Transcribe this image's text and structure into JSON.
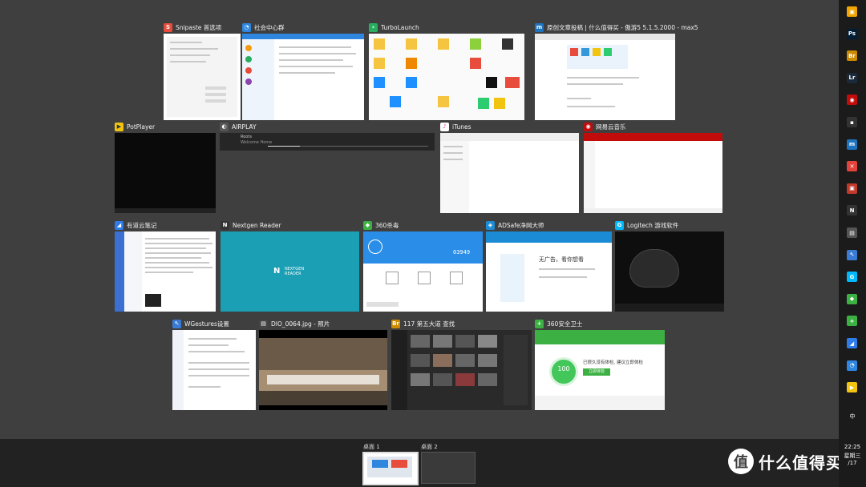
{
  "windows": {
    "snipaste": {
      "title": "Snipaste 首选项",
      "icon": "snipaste-icon",
      "color": "#e74c3c"
    },
    "social": {
      "title": "社会中心群",
      "icon": "tim-icon",
      "color": "#2e86de"
    },
    "turbolaunch": {
      "title": "TurboLaunch",
      "icon": "turbolaunch-icon",
      "color": "#27ae60"
    },
    "maxthon": {
      "title": "原创文章投稿 | 什么值得买 - 傲游5 5.1.5.2000 - max5",
      "icon": "maxthon-icon",
      "color": "#1e73be"
    },
    "potplayer": {
      "title": "PotPlayer",
      "icon": "potplayer-icon",
      "color": "#f1c40f"
    },
    "airplay": {
      "title": "AIRPLAY",
      "icon": "airplay-icon",
      "color": "#555555",
      "track": "Roots",
      "artist": "Welcome Home"
    },
    "itunes": {
      "title": "iTunes",
      "icon": "itunes-icon",
      "color": "#ffffff"
    },
    "netease_music": {
      "title": "网易云音乐",
      "icon": "netease-music-icon",
      "color": "#c20c0c"
    },
    "youdao": {
      "title": "有道云笔记",
      "icon": "youdao-note-icon",
      "color": "#2f7ce8"
    },
    "nextgen": {
      "title": "Nextgen Reader",
      "icon": "nextgen-icon",
      "color": "#1a9fb5",
      "logo_line1": "NEXTGEN",
      "logo_line2": "READER"
    },
    "antivirus360": {
      "title": "360杀毒",
      "icon": "360-antivirus-icon",
      "color": "#3cb043",
      "count": "03949"
    },
    "adsafe": {
      "title": "ADSafe净网大师",
      "icon": "adsafe-icon",
      "color": "#1c8bd6",
      "headline": "无广告，看你想看"
    },
    "logitech": {
      "title": "Logitech 游戏软件",
      "icon": "logitech-icon",
      "color": "#00b8fc"
    },
    "wgestures": {
      "title": "WGestures设置",
      "icon": "wgestures-icon",
      "color": "#3a7bd5"
    },
    "photo": {
      "title": "DIO_0064.jpg - 照片",
      "icon": "photos-icon",
      "color": "#444444"
    },
    "bridge": {
      "title": "117 第五大道 查找",
      "icon": "bridge-icon",
      "color": "#cc8a00",
      "icon_text": "Br"
    },
    "safeguard360": {
      "title": "360安全卫士",
      "icon": "360-safe-icon",
      "color": "#3cb043",
      "score": "100",
      "message": "已很久没有体检, 建议立即体检",
      "button": "立即体检"
    }
  },
  "desktops": [
    {
      "label": "桌面 1",
      "active": true
    },
    {
      "label": "桌面 2",
      "active": false
    }
  ],
  "clock": {
    "time": "22:25",
    "weekday": "星期三",
    "date": "/17"
  },
  "ime": "中",
  "watermark": {
    "symbol": "值",
    "text": "什么值得买"
  },
  "taskbar_icons": [
    {
      "name": "store-icon",
      "color": "#f0a500",
      "text": "▣"
    },
    {
      "name": "photoshop-icon",
      "color": "#001e36",
      "text": "Ps"
    },
    {
      "name": "bridge-icon",
      "color": "#cc8a00",
      "text": "Br"
    },
    {
      "name": "lightroom-icon",
      "color": "#1b2a3a",
      "text": "Lr"
    },
    {
      "name": "netease-music-icon",
      "color": "#c20c0c",
      "text": "◉"
    },
    {
      "name": "unknown-app-icon",
      "color": "#333333",
      "text": "▪"
    },
    {
      "name": "maxthon-icon",
      "color": "#1e73be",
      "text": "m"
    },
    {
      "name": "xmind-icon",
      "color": "#e2433a",
      "text": "✕"
    },
    {
      "name": "present-icon",
      "color": "#c0392b",
      "text": "▣"
    },
    {
      "name": "nextgen-icon",
      "color": "#333333",
      "text": "N"
    },
    {
      "name": "photos-icon",
      "color": "#555555",
      "text": "▤"
    },
    {
      "name": "wgestures-icon",
      "color": "#3a7bd5",
      "text": "↖"
    },
    {
      "name": "logitech-icon",
      "color": "#00b8fc",
      "text": "G"
    },
    {
      "name": "360-antivirus-icon",
      "color": "#3cb043",
      "text": "◆"
    },
    {
      "name": "360-safe-icon",
      "color": "#3cb043",
      "text": "+"
    },
    {
      "name": "youdao-note-icon",
      "color": "#2f7ce8",
      "text": "◢"
    },
    {
      "name": "tim-icon",
      "color": "#2e86de",
      "text": "◔"
    },
    {
      "name": "potplayer-icon",
      "color": "#f1c40f",
      "text": "▶"
    }
  ]
}
